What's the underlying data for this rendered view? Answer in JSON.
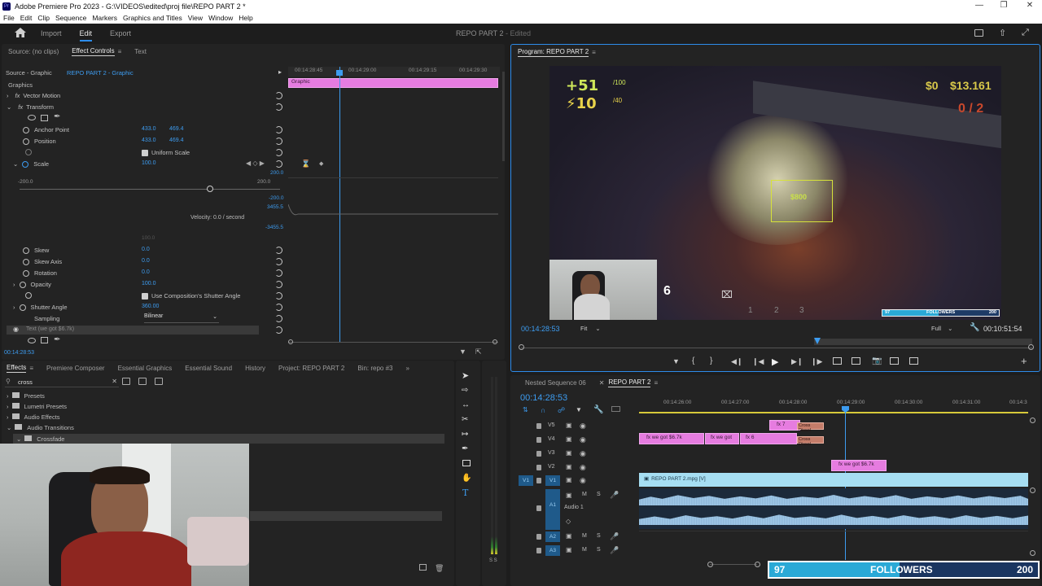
{
  "app": {
    "title": "Adobe Premiere Pro 2023 - G:\\VIDEOS\\edited\\proj file\\REPO PART 2 *",
    "logo_text": "Pr"
  },
  "menu": [
    "File",
    "Edit",
    "Clip",
    "Sequence",
    "Markers",
    "Graphics and Titles",
    "View",
    "Window",
    "Help"
  ],
  "workspace": {
    "tabs": [
      "Import",
      "Edit",
      "Export"
    ],
    "active": "Edit",
    "project": "REPO PART 2",
    "status": "- Edited"
  },
  "effect_controls": {
    "tabs": [
      "Source: (no clips)",
      "Effect Controls",
      "Text"
    ],
    "clip_label": "Source - Graphic",
    "sequence_label": "REPO PART 2 - Graphic",
    "timecodes": [
      "00:14:28:45",
      "00:14:29:00",
      "00:14:29:15",
      "00:14:29:30"
    ],
    "graphic_clip": "Graphic",
    "section": "Graphics",
    "vector_motion": "Vector Motion",
    "transform": "Transform",
    "anchor_point": {
      "label": "Anchor Point",
      "x": "433.0",
      "y": "469.4"
    },
    "position": {
      "label": "Position",
      "x": "433.0",
      "y": "469.4"
    },
    "uniform_scale": "Uniform Scale",
    "scale": {
      "label": "Scale",
      "value": "100.0"
    },
    "graph_max": "200.0",
    "graph_min": "-200.0",
    "graph_right_top": "200.0",
    "graph_right_neg": "-200.0",
    "vel_top": "3455.5",
    "vel_bottom": "-3455.5",
    "velocity": "Velocity: 0.0 / second",
    "scale_width": "100.0",
    "skew": {
      "label": "Skew",
      "value": "0.0"
    },
    "skew_axis": {
      "label": "Skew Axis",
      "value": "0.0"
    },
    "rotation": {
      "label": "Rotation",
      "value": "0.0"
    },
    "opacity": {
      "label": "Opacity",
      "value": "100.0"
    },
    "shutter": "Use Composition's Shutter Angle",
    "shutter_angle": {
      "label": "Shutter Angle",
      "value": "360.00"
    },
    "sampling": {
      "label": "Sampling",
      "value": "Bilinear"
    },
    "text_layer": "Text (we got $6.7k)",
    "current_time": "00:14:28:53"
  },
  "effects_panel": {
    "tabs": [
      "Effects",
      "Premiere Composer",
      "Essential Graphics",
      "Essential Sound",
      "History",
      "Project: REPO PART 2",
      "Bin: repo #3"
    ],
    "search_value": "cross",
    "tree": [
      "Presets",
      "Lumetri Presets",
      "Audio Effects",
      "Audio Transitions",
      "Crossfade"
    ]
  },
  "program_monitor": {
    "title": "Program: REPO PART 2",
    "timecode": "00:14:28:53",
    "fit": "Fit",
    "quality": "Full",
    "duration": "00:10:51:54",
    "hud": {
      "health": "+51",
      "health_max": "/100",
      "stamina": "10",
      "stamina_max": "/40",
      "money": "$0",
      "money_total": "$13.161",
      "goal": "0 / 2",
      "item_value": "$800",
      "slots": [
        "1",
        "2",
        "3"
      ],
      "countdown": "6",
      "followers_count": "97",
      "followers_label": "FOLLOWERS",
      "followers_goal": "200"
    }
  },
  "timeline": {
    "tabs": [
      "Nested Sequence 06",
      "REPO PART 2"
    ],
    "active": "REPO PART 2",
    "timecode": "00:14:28:53",
    "ruler": [
      "00:14:26:00",
      "00:14:27:00",
      "00:14:28:00",
      "00:14:29:00",
      "00:14:30:00",
      "00:14:31:00",
      "00:14:3"
    ],
    "tracks": [
      {
        "name": "V5",
        "type": "video"
      },
      {
        "name": "V4",
        "type": "video"
      },
      {
        "name": "V3",
        "type": "video"
      },
      {
        "name": "V2",
        "type": "video"
      },
      {
        "name": "V1",
        "type": "video",
        "source": "V1"
      },
      {
        "name": "A1",
        "type": "audio",
        "label": "Audio 1"
      },
      {
        "name": "A2",
        "type": "audio"
      },
      {
        "name": "A3",
        "type": "audio"
      }
    ],
    "clips": {
      "v5_a": "fx 7",
      "v5_b": "Cross Dissol",
      "v4_a": "fx we got $6.7k",
      "v4_b": "fx we got",
      "v4_c": "fx 6",
      "v4_d": "Cross Dissol",
      "v2": "fx we got $6.7k",
      "v1": "REPO PART 2.mpg [V]"
    }
  },
  "overlay": {
    "followers_count": "97",
    "followers_label": "FOLLOWERS",
    "followers_goal": "200",
    "progress": 0.485
  },
  "colors": {
    "accent": "#2d8ceb",
    "clip_pink": "#e67ce0",
    "clip_blue": "#a6def2",
    "followers_bar": "#2aa9d6"
  }
}
